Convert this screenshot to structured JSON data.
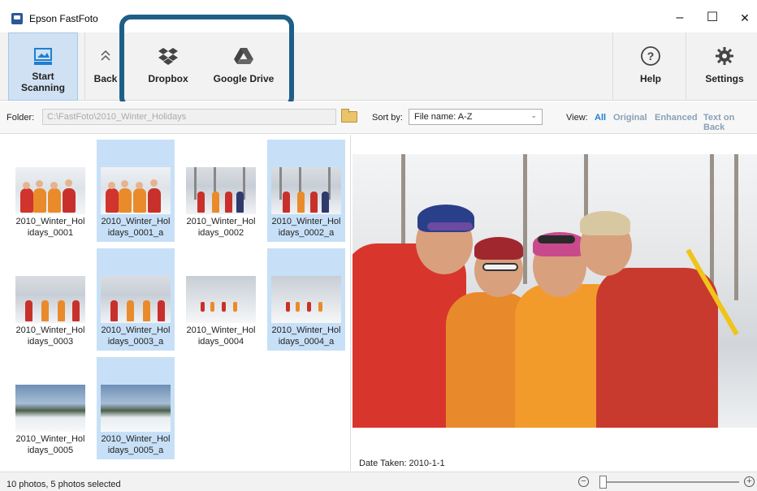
{
  "window": {
    "title": "Epson FastFoto",
    "minimize": "–",
    "maximize": "☐",
    "close": "✕"
  },
  "ribbon": {
    "start_scanning": "Start\nScanning",
    "backup": "Back",
    "dropbox": "Dropbox",
    "google_drive": "Google Drive",
    "help": "Help",
    "settings": "Settings"
  },
  "folderbar": {
    "folder_label": "Folder:",
    "folder_value": "C:\\FastFoto\\2010_Winter_Holidays",
    "sort_label": "Sort by:",
    "sort_value": "File name: A-Z",
    "view_label": "View:",
    "view_options": [
      "All",
      "Original",
      "Enhanced",
      "Text on Back"
    ],
    "view_selected": "All"
  },
  "thumbnails": [
    {
      "caption": "2010_Winter_Hol\nidays_0001",
      "selected": false
    },
    {
      "caption": "2010_Winter_Hol\nidays_0001_a",
      "selected": true
    },
    {
      "caption": "2010_Winter_Hol\nidays_0002",
      "selected": false
    },
    {
      "caption": "2010_Winter_Hol\nidays_0002_a",
      "selected": true
    },
    {
      "caption": "2010_Winter_Hol\nidays_0003",
      "selected": false
    },
    {
      "caption": "2010_Winter_Hol\nidays_0003_a",
      "selected": true
    },
    {
      "caption": "2010_Winter_Hol\nidays_0004",
      "selected": false
    },
    {
      "caption": "2010_Winter_Hol\nidays_0004_a",
      "selected": true
    },
    {
      "caption": "2010_Winter_Hol\nidays_0005",
      "selected": false
    },
    {
      "caption": "2010_Winter_Hol\nidays_0005_a",
      "selected": true
    }
  ],
  "preview": {
    "date_taken": "Date Taken: 2010-1-1"
  },
  "status": {
    "text": "10 photos, 5 photos selected",
    "zoom_out": "−",
    "zoom_in": "+"
  },
  "colors": {
    "accent": "#1f7fd0",
    "selection": "#c7e0f7",
    "highlight_frame": "#1d5f87"
  }
}
